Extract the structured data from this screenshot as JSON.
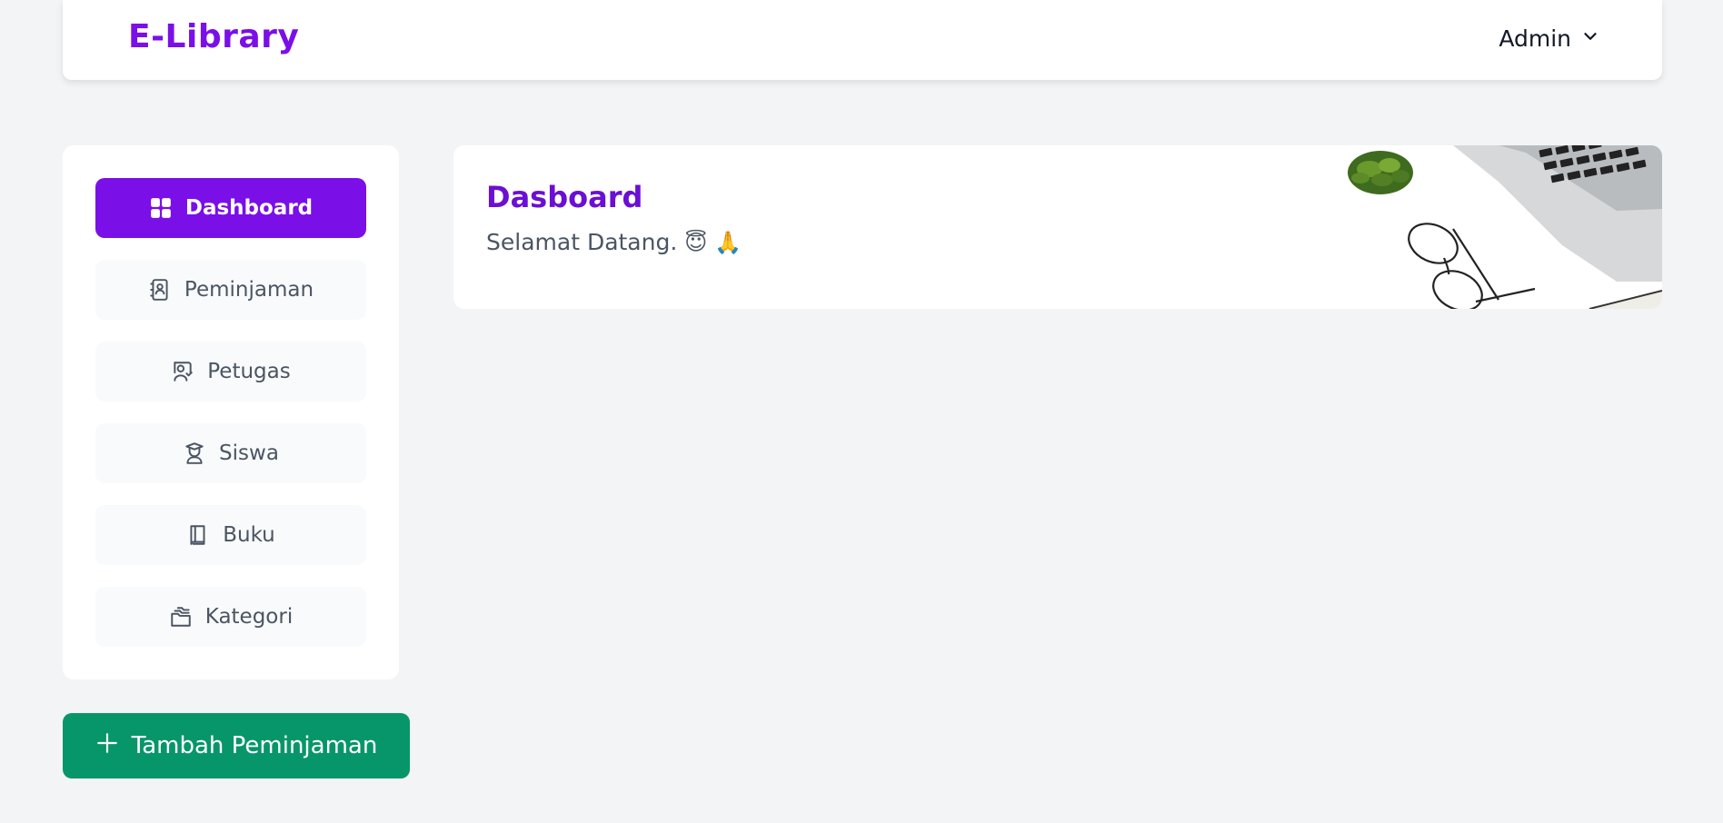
{
  "header": {
    "brand": "E-Library",
    "user_label": "Admin",
    "user_menu_icon": "chevron-down-icon"
  },
  "sidebar": {
    "items": [
      {
        "label": "Dashboard",
        "icon": "dashboard-grid-icon",
        "active": true
      },
      {
        "label": "Peminjaman",
        "icon": "address-book-icon",
        "active": false
      },
      {
        "label": "Petugas",
        "icon": "officer-card-icon",
        "active": false
      },
      {
        "label": "Siswa",
        "icon": "student-icon",
        "active": false
      },
      {
        "label": "Buku",
        "icon": "book-icon",
        "active": false
      },
      {
        "label": "Kategori",
        "icon": "folders-icon",
        "active": false
      }
    ]
  },
  "actions": {
    "add_loan_label": "Tambah Peminjaman",
    "add_loan_icon": "plus-icon"
  },
  "banner": {
    "title": "Dasboard",
    "subtitle": "Selamat Datang.",
    "emojis": [
      "😇",
      "🙏"
    ]
  },
  "colors": {
    "accent": "#7a0fe8",
    "success": "#079669",
    "background": "#f3f4f6"
  }
}
